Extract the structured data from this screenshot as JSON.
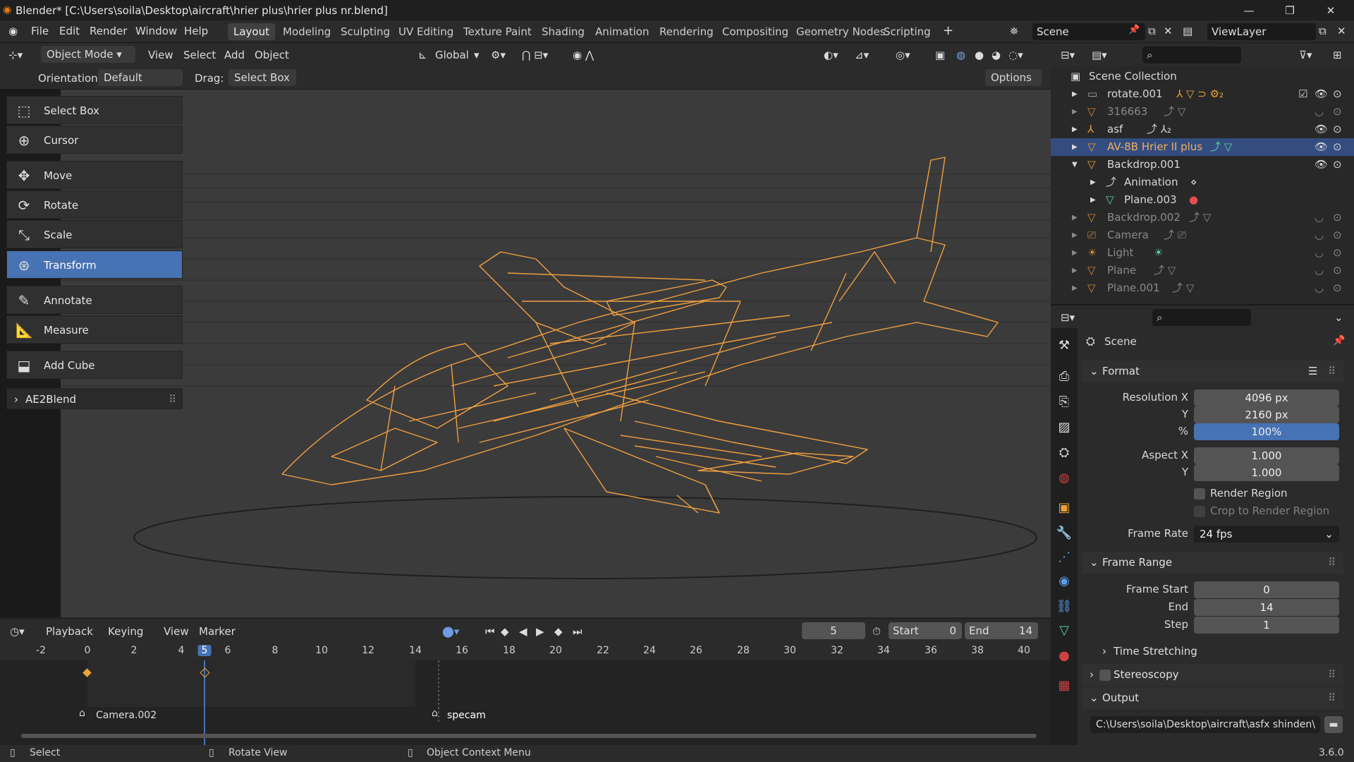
{
  "title_bar": {
    "title": "Blender* [C:\\Users\\soila\\Desktop\\aircraft\\hrier plus\\hrier plus nr.blend]",
    "minimize": "—",
    "maximize": "❐",
    "close": "✕"
  },
  "menu": [
    "File",
    "Edit",
    "Render",
    "Window",
    "Help"
  ],
  "workspaces": [
    "Layout",
    "Modeling",
    "Sculpting",
    "UV Editing",
    "Texture Paint",
    "Shading",
    "Animation",
    "Rendering",
    "Compositing",
    "Geometry Nodes",
    "Scripting"
  ],
  "scene_name": "Scene",
  "view_layer": "ViewLayer",
  "viewport_header": {
    "mode": "Object Mode",
    "menus": [
      "View",
      "Select",
      "Add",
      "Object"
    ],
    "transform_orientation": "Global"
  },
  "tool_settings": {
    "orientation_label": "Orientation:",
    "orientation": "Default",
    "drag_label": "Drag:",
    "drag": "Select Box",
    "options": "Options"
  },
  "tools": [
    {
      "label": "Select Box",
      "icon": "select-box-icon",
      "glyph": "⬚"
    },
    {
      "label": "Cursor",
      "icon": "cursor-icon",
      "glyph": "⊕"
    },
    {
      "label": "Move",
      "icon": "move-icon",
      "glyph": "✥"
    },
    {
      "label": "Rotate",
      "icon": "rotate-icon",
      "glyph": "⟳"
    },
    {
      "label": "Scale",
      "icon": "scale-icon",
      "glyph": "⤡"
    },
    {
      "label": "Transform",
      "icon": "transform-icon",
      "glyph": "⊛"
    },
    {
      "label": "Annotate",
      "icon": "annotate-icon",
      "glyph": "✎"
    },
    {
      "label": "Measure",
      "icon": "measure-icon",
      "glyph": "📐"
    },
    {
      "label": "Add Cube",
      "icon": "add-cube-icon",
      "glyph": "⬓"
    }
  ],
  "addon_panel": "AE2Blend",
  "outliner": {
    "root": "Scene Collection",
    "items": [
      {
        "name": "rotate.001",
        "dim": false
      },
      {
        "name": "316663",
        "dim": true
      },
      {
        "name": "asf",
        "dim": false
      },
      {
        "name": "AV-8B Hrier II plus",
        "dim": false,
        "selected": true
      },
      {
        "name": "Backdrop.001",
        "dim": false
      },
      {
        "name": "Animation",
        "dim": false,
        "child": true
      },
      {
        "name": "Plane.003",
        "dim": false,
        "child": true
      },
      {
        "name": "Backdrop.002",
        "dim": true
      },
      {
        "name": "Camera",
        "dim": true
      },
      {
        "name": "Light",
        "dim": true
      },
      {
        "name": "Plane",
        "dim": true
      },
      {
        "name": "Plane.001",
        "dim": true
      }
    ]
  },
  "properties": {
    "context": "Scene",
    "format_header": "Format",
    "resolution_x_label": "Resolution X",
    "resolution_x": "4096 px",
    "resolution_y_label": "Y",
    "resolution_y": "2160 px",
    "percent_label": "%",
    "percent": "100%",
    "aspect_x_label": "Aspect X",
    "aspect_x": "1.000",
    "aspect_y_label": "Y",
    "aspect_y": "1.000",
    "render_region": "Render Region",
    "crop_region": "Crop to Render Region",
    "frame_rate_label": "Frame Rate",
    "frame_rate": "24 fps",
    "frame_range_header": "Frame Range",
    "frame_start_label": "Frame Start",
    "frame_start": "0",
    "end_label": "End",
    "end": "14",
    "step_label": "Step",
    "step": "1",
    "time_stretching": "Time Stretching",
    "stereoscopy": "Stereoscopy",
    "output_header": "Output",
    "output_path": "C:\\Users\\soila\\Desktop\\aircraft\\asfx shinden\\"
  },
  "timeline": {
    "menus": [
      "Playback",
      "Keying",
      "View",
      "Marker"
    ],
    "current_frame": "5",
    "start_label": "Start",
    "start": "0",
    "end_label": "End",
    "end": "14",
    "ruler": [
      "-2",
      "0",
      "2",
      "4",
      "5",
      "6",
      "8",
      "10",
      "12",
      "14",
      "16",
      "18",
      "20",
      "22",
      "24",
      "26",
      "28",
      "30",
      "32",
      "34",
      "36",
      "38",
      "40"
    ],
    "markers": [
      "Camera.002",
      "specam"
    ]
  },
  "status_bar": {
    "select": "Select",
    "rotate": "Rotate View",
    "context": "Object Context Menu",
    "version": "3.6.0"
  },
  "colors": {
    "accent": "#4772b3",
    "wire": "#f0a040",
    "selected_row": "#334d80"
  }
}
